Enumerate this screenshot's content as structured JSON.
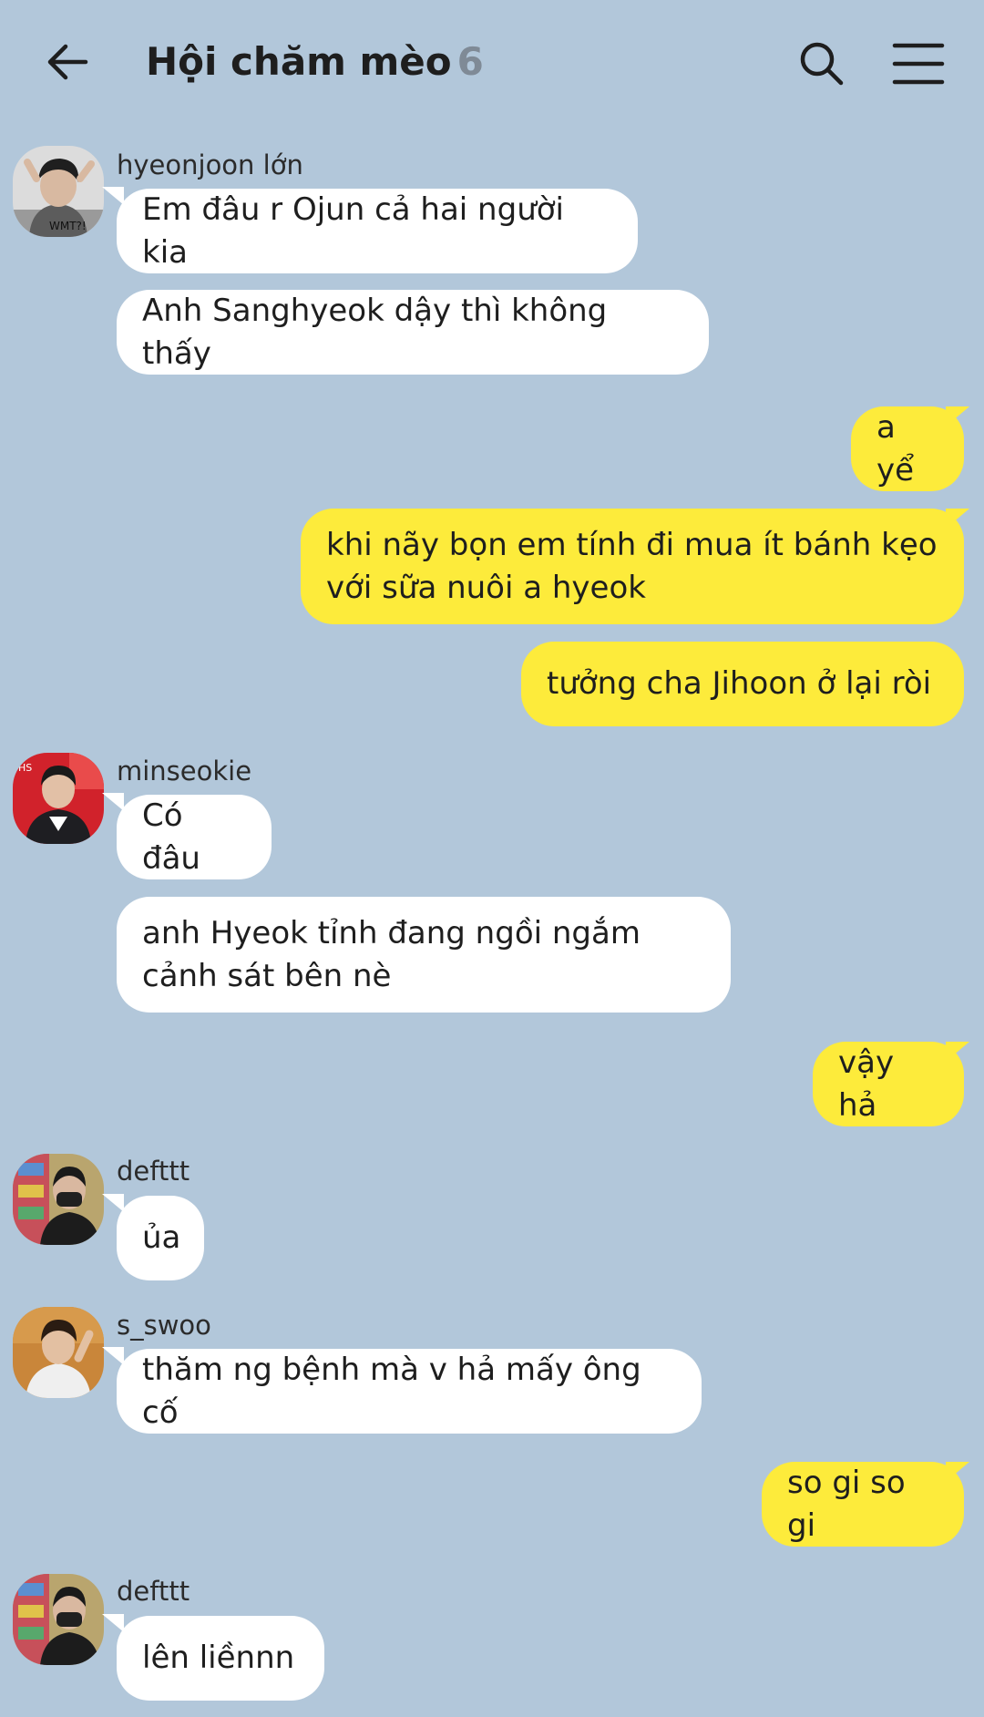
{
  "header": {
    "title": "Hội chăm mèo",
    "member_count": "6",
    "icons": [
      "back-arrow-icon",
      "search-icon",
      "menu-icon"
    ]
  },
  "colors": {
    "background": "#b2c7da",
    "incoming_bubble": "#ffffff",
    "outgoing_bubble": "#fdeb3b",
    "member_count": "#7f8a96"
  },
  "messages": {
    "m1": {
      "sender": "hyeonjoon lớn",
      "bubbles": [
        "Em đâu r Ojun cả hai người kia",
        "Anh Sanghyeok dậy thì không thấy"
      ]
    },
    "m2": {
      "bubbles": [
        "a yể",
        "khi nãy bọn em tính đi mua ít bánh kẹo\nvới sữa nuôi a hyeok",
        "tưởng cha Jihoon ở lại ròi"
      ]
    },
    "m3": {
      "sender": "minseokie",
      "bubbles": [
        "Có đâu",
        "anh Hyeok tỉnh đang ngồi ngắm\ncảnh sát bên nè"
      ]
    },
    "m4": {
      "bubbles": [
        "vậy hả"
      ]
    },
    "m5": {
      "sender": "defttt",
      "bubbles": [
        "ủa"
      ]
    },
    "m6": {
      "sender": "s_swoo",
      "bubbles": [
        "thăm ng bệnh mà v hả mấy ông cố"
      ]
    },
    "m7": {
      "bubbles": [
        "so gi so gi"
      ]
    },
    "m8": {
      "sender": "defttt",
      "bubbles": [
        "lên liềnnn"
      ]
    }
  }
}
